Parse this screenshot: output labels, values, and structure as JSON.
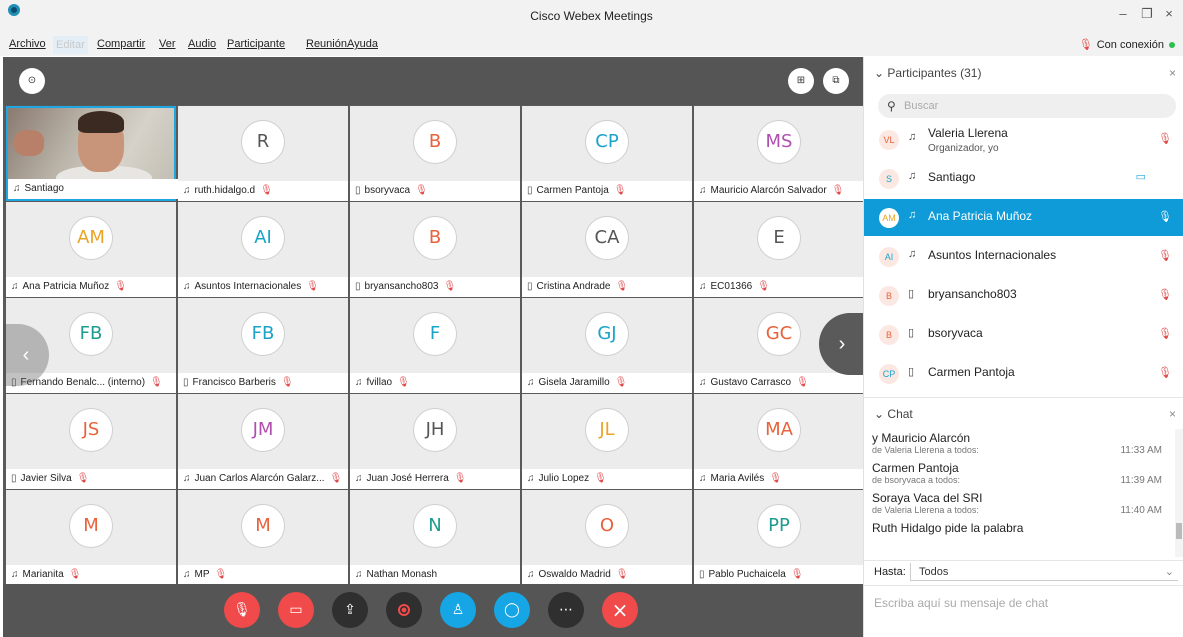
{
  "window": {
    "title": "Cisco Webex Meetings",
    "minimize_glyph": "–",
    "restore_glyph": "❐",
    "close_glyph": "×"
  },
  "menu": {
    "items": [
      "Archivo",
      "Editar",
      "Compartir",
      "Ver",
      "Audio",
      "Participante",
      "Reunión",
      "Ayuda"
    ],
    "connection": "Con conexión"
  },
  "colors": {
    "accent": "#0f9bd7",
    "mute": "#e04848",
    "end": "#f04a4a",
    "online": "#2bbf4f"
  },
  "video": {
    "top_left_icon": "info-icon",
    "top_right_icons": [
      "grid-view-icon",
      "popout-icon"
    ],
    "tiles": [
      {
        "initials": "",
        "name": "Santiago",
        "device": "headset",
        "muted": false,
        "color": "#333",
        "video": true
      },
      {
        "initials": "R",
        "name": "ruth.hidalgo.d",
        "device": "headset",
        "muted": true,
        "color": "#555"
      },
      {
        "initials": "B",
        "name": "bsoryvaca",
        "device": "phone",
        "muted": true,
        "color": "#e8623a"
      },
      {
        "initials": "CP",
        "name": "Carmen Pantoja",
        "device": "phone",
        "muted": true,
        "color": "#1aa3c9"
      },
      {
        "initials": "MS",
        "name": "Mauricio Alarcón Salvador",
        "device": "headset",
        "muted": true,
        "color": "#b04fb0"
      },
      {
        "initials": "AM",
        "name": "Ana Patricia Muñoz",
        "device": "headset",
        "muted": true,
        "color": "#e9a526"
      },
      {
        "initials": "AI",
        "name": "Asuntos Internacionales",
        "device": "headset",
        "muted": true,
        "color": "#1aa3c9"
      },
      {
        "initials": "B",
        "name": "bryansancho803",
        "device": "phone",
        "muted": true,
        "color": "#e8623a"
      },
      {
        "initials": "CA",
        "name": "Cristina Andrade",
        "device": "phone",
        "muted": true,
        "color": "#555"
      },
      {
        "initials": "E",
        "name": "EC01366",
        "device": "headset",
        "muted": true,
        "color": "#555"
      },
      {
        "initials": "FB",
        "name": "Fernando Benalc... (interno)",
        "device": "phone",
        "muted": true,
        "color": "#1f9b8f"
      },
      {
        "initials": "FB",
        "name": "Francisco Barberis",
        "device": "phone",
        "muted": true,
        "color": "#1aa3c9"
      },
      {
        "initials": "F",
        "name": "fvillao",
        "device": "headset",
        "muted": true,
        "color": "#1aa3c9"
      },
      {
        "initials": "GJ",
        "name": "Gisela Jaramillo",
        "device": "headset",
        "muted": true,
        "color": "#1aa3c9"
      },
      {
        "initials": "GC",
        "name": "Gustavo Carrasco",
        "device": "headset",
        "muted": true,
        "color": "#e8623a"
      },
      {
        "initials": "JS",
        "name": "Javier Silva",
        "device": "phone",
        "muted": true,
        "color": "#e8623a"
      },
      {
        "initials": "JM",
        "name": "Juan Carlos Alarcón Galarz...",
        "device": "headset",
        "muted": true,
        "color": "#b04fb0"
      },
      {
        "initials": "JH",
        "name": "Juan José Herrera",
        "device": "headset",
        "muted": true,
        "color": "#555"
      },
      {
        "initials": "JL",
        "name": "Julio Lopez",
        "device": "headset",
        "muted": true,
        "color": "#e9a526"
      },
      {
        "initials": "MA",
        "name": "Maria Avilés",
        "device": "headset",
        "muted": true,
        "color": "#e8623a"
      },
      {
        "initials": "M",
        "name": "Marianita",
        "device": "headset",
        "muted": true,
        "color": "#e8623a"
      },
      {
        "initials": "M",
        "name": "MP",
        "device": "headset",
        "muted": true,
        "color": "#e8623a"
      },
      {
        "initials": "N",
        "name": "Nathan Monash",
        "device": "headset",
        "muted": false,
        "color": "#1f9b8f"
      },
      {
        "initials": "O",
        "name": "Oswaldo Madrid",
        "device": "headset",
        "muted": true,
        "color": "#e8623a"
      },
      {
        "initials": "PP",
        "name": "Pablo Puchaicela",
        "device": "phone",
        "muted": true,
        "color": "#1f9b8f"
      }
    ],
    "controls": [
      "mute-icon",
      "video-off-icon",
      "share-icon",
      "record-icon",
      "participants-icon",
      "chat-icon",
      "more-icon",
      "end-call-icon"
    ]
  },
  "participants": {
    "header": "Participantes (31)",
    "search_placeholder": "Buscar",
    "list": [
      {
        "initials": "VL",
        "name": "Valeria Llerena",
        "sub": "Organizador, yo",
        "device": "headset",
        "muted": true,
        "color": "#e8623a"
      },
      {
        "initials": "S",
        "name": "Santiago",
        "sub": "",
        "device": "headset",
        "muted": false,
        "video": true,
        "color": "#1aa3c9"
      },
      {
        "initials": "AM",
        "name": "Ana Patricia Muñoz",
        "sub": "",
        "device": "headset",
        "muted": true,
        "selected": true,
        "color": "#e9a526"
      },
      {
        "initials": "AI",
        "name": "Asuntos Internacionales",
        "sub": "",
        "device": "headset",
        "muted": true,
        "color": "#1aa3c9"
      },
      {
        "initials": "B",
        "name": "bryansancho803",
        "sub": "",
        "device": "phone",
        "muted": true,
        "color": "#e8623a"
      },
      {
        "initials": "B",
        "name": "bsoryvaca",
        "sub": "",
        "device": "phone",
        "muted": true,
        "color": "#e8623a"
      },
      {
        "initials": "CP",
        "name": "Carmen Pantoja",
        "sub": "",
        "device": "phone",
        "muted": true,
        "color": "#1aa3c9"
      }
    ]
  },
  "chat": {
    "header": "Chat",
    "messages": [
      {
        "text": "y Mauricio Alarcón",
        "meta": "de Valeria Llerena a todos:",
        "time": "11:33 AM"
      },
      {
        "text": "Carmen Pantoja",
        "meta": "de bsoryvaca a todos:",
        "time": "11:39 AM"
      },
      {
        "text": "Soraya Vaca del SRI",
        "meta": "de Valeria Llerena a todos:",
        "time": "11:40 AM"
      },
      {
        "text": "Ruth Hidalgo pide la palabra",
        "meta": "",
        "time": ""
      }
    ],
    "to_label": "Hasta:",
    "to_value": "Todos",
    "input_placeholder": "Escriba aquí su mensaje de chat"
  }
}
